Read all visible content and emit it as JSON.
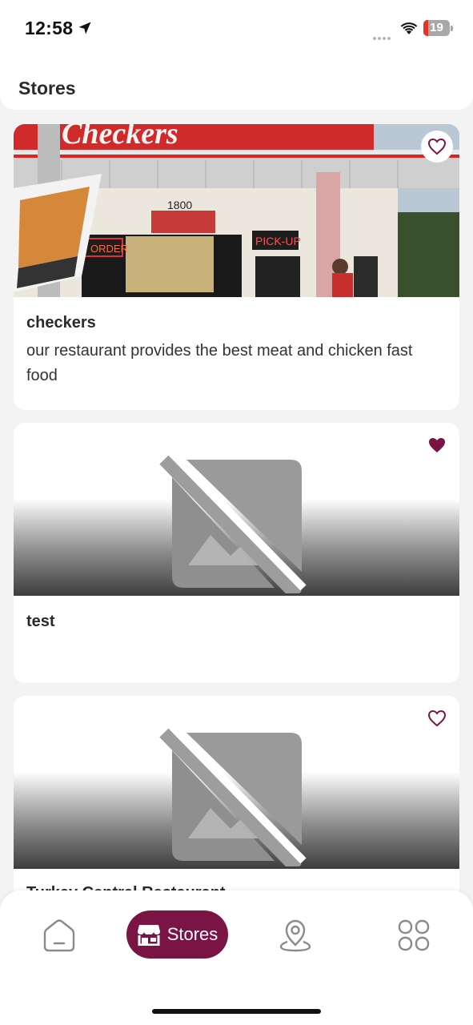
{
  "status_bar": {
    "time": "12:58",
    "battery": "19",
    "battery_percent": 19,
    "battery_low_color": "#e5332a"
  },
  "header": {
    "title": "Stores"
  },
  "stores": [
    {
      "name": "checkers",
      "description": "our restaurant provides the best meat and chicken fast food",
      "favorite": false,
      "image": "storefront-photo"
    },
    {
      "name": "test",
      "description": "",
      "favorite": true,
      "image": "broken-image-icon"
    },
    {
      "name": "Turkey Central Restaurant",
      "description": "",
      "favorite": false,
      "image": "broken-image-icon"
    }
  ],
  "bottom_nav": {
    "items": [
      {
        "icon": "home-icon",
        "label": "",
        "active": false
      },
      {
        "icon": "store-icon",
        "label": "Stores",
        "active": true
      },
      {
        "icon": "map-pin-icon",
        "label": "",
        "active": false
      },
      {
        "icon": "grid-icon",
        "label": "",
        "active": false
      }
    ]
  },
  "colors": {
    "accent": "#7a1445",
    "background": "#f3f3f3",
    "card": "#ffffff"
  }
}
